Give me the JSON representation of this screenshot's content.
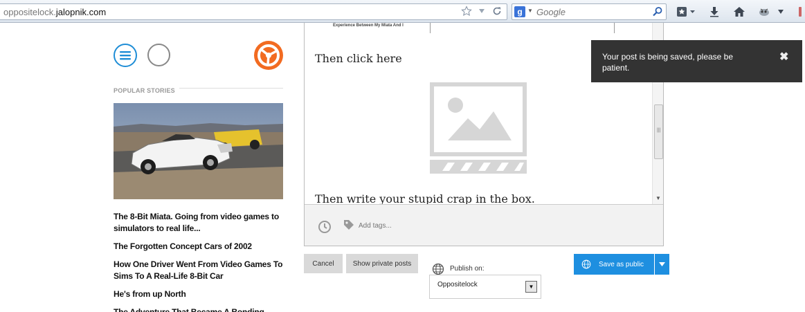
{
  "browser": {
    "url_prefix": "oppositelock.",
    "url_domain": "jalopnik.com",
    "search_placeholder": "Google",
    "search_engine_badge": "g"
  },
  "sidebar": {
    "popular_label": "POPULAR STORIES",
    "stories": [
      "The 8-Bit Miata. Going from video games to simulators to real life...",
      "The Forgotten Concept Cars of 2002",
      "How One Driver Went From Video Games To Sims To A Real-Life 8-Bit Car",
      "He's from up North",
      "The Adventure That Became A Bonding"
    ]
  },
  "editor": {
    "embed_snippet": "The Adventure That Became A Bonding Experience Between My Miata And I",
    "line1": "Then click here",
    "line2": "Then write your stupid crap in the box.",
    "tags_placeholder": "Add tags..."
  },
  "actions": {
    "cancel": "Cancel",
    "show_private": "Show private posts",
    "publish_on_label": "Publish on:",
    "publish_on_value": "Oppositelock",
    "save_public": "Save as public"
  },
  "toast": {
    "message": "Your post is being saved, please be patient.",
    "close": "✖"
  },
  "colors": {
    "accent_blue": "#1e8fe0",
    "brand_orange": "#f26b21",
    "toast_bg": "#333333"
  }
}
